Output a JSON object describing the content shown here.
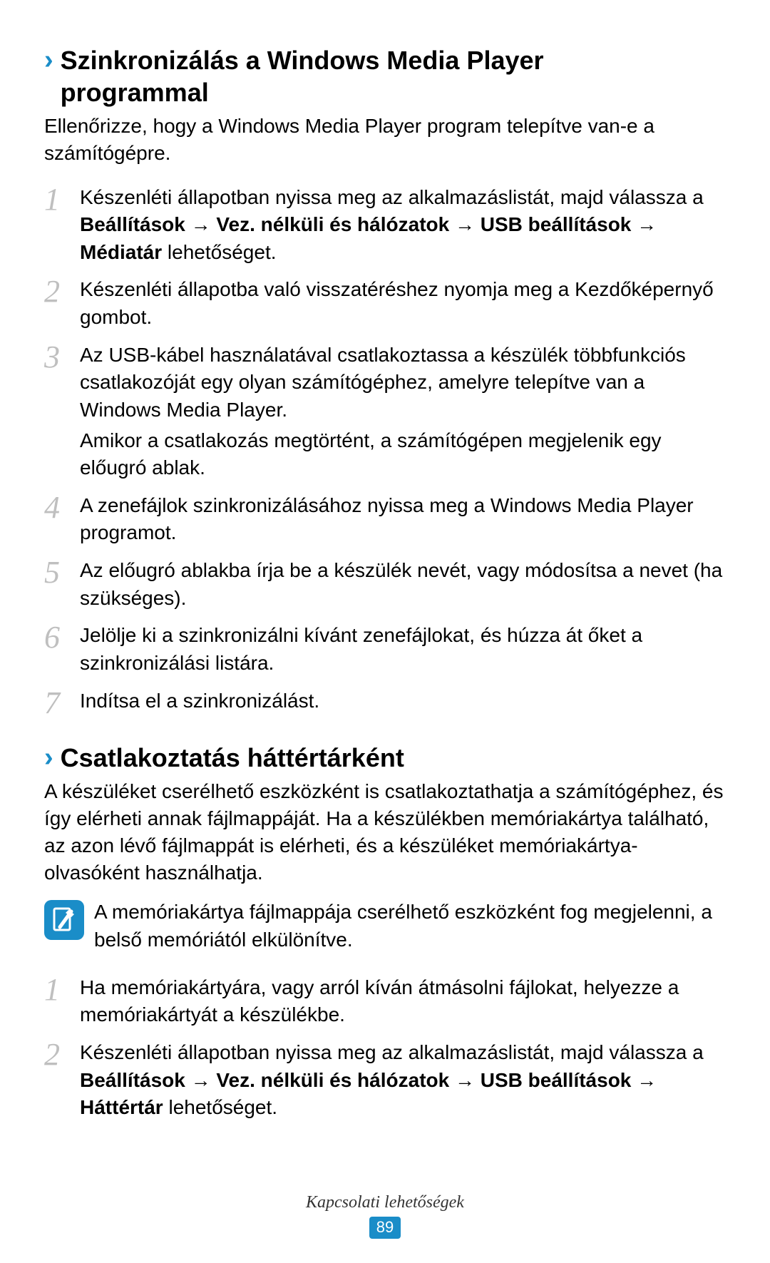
{
  "section1": {
    "chevron": "›",
    "heading_line1": "Szinkronizálás a Windows Media Player",
    "heading_line2": "programmal",
    "intro": "Ellenőrizze, hogy a Windows Media Player program telepítve van-e a számítógépre.",
    "steps": [
      {
        "pre": "Készenléti állapotban nyissa meg az alkalmazáslistát, majd válassza a ",
        "bold": "Beállítások → Vez. nélküli és hálózatok → USB beállítások → Médiatár",
        "post": " lehetőséget."
      },
      {
        "pre": "Készenléti állapotba való visszatéréshez nyomja meg a Kezdőképernyő gombot.",
        "bold": "",
        "post": ""
      },
      {
        "pre": "Az USB-kábel használatával csatlakoztassa a készülék többfunkciós csatlakozóját egy olyan számítógéphez, amelyre telepítve van a Windows Media Player.",
        "bold": "",
        "post": "",
        "extra": "Amikor a csatlakozás megtörtént, a számítógépen megjelenik egy előugró ablak."
      },
      {
        "pre": "A zenefájlok szinkronizálásához nyissa meg a Windows Media Player programot.",
        "bold": "",
        "post": ""
      },
      {
        "pre": "Az előugró ablakba írja be a készülék nevét, vagy módosítsa a nevet (ha szükséges).",
        "bold": "",
        "post": ""
      },
      {
        "pre": "Jelölje ki a szinkronizálni kívánt zenefájlokat, és húzza át őket a szinkronizálási listára.",
        "bold": "",
        "post": ""
      },
      {
        "pre": "Indítsa el a szinkronizálást.",
        "bold": "",
        "post": ""
      }
    ]
  },
  "section2": {
    "chevron": "›",
    "heading": "Csatlakoztatás háttértárként",
    "intro": "A készüléket cserélhető eszközként is csatlakoztathatja a számítógéphez, és így elérheti annak fájlmappáját. Ha a készülékben memóriakártya található, az azon lévő fájlmappát is elérheti, és a készüléket memóriakártya-olvasóként használhatja.",
    "note": "A memóriakártya fájlmappája cserélhető eszközként fog megjelenni, a belső memóriától elkülönítve.",
    "steps": [
      {
        "pre": "Ha memóriakártyára, vagy arról kíván átmásolni fájlokat, helyezze a memóriakártyát a készülékbe.",
        "bold": "",
        "post": ""
      },
      {
        "pre": "Készenléti állapotban nyissa meg az alkalmazáslistát, majd válassza a ",
        "bold": "Beállítások → Vez. nélküli és hálózatok → USB beállítások → Háttértár",
        "post": " lehetőséget."
      }
    ]
  },
  "footer": {
    "label": "Kapcsolati lehetőségek",
    "page": "89"
  },
  "colors": {
    "accent": "#1a8dc8",
    "step_number": "#bfbfbf"
  }
}
